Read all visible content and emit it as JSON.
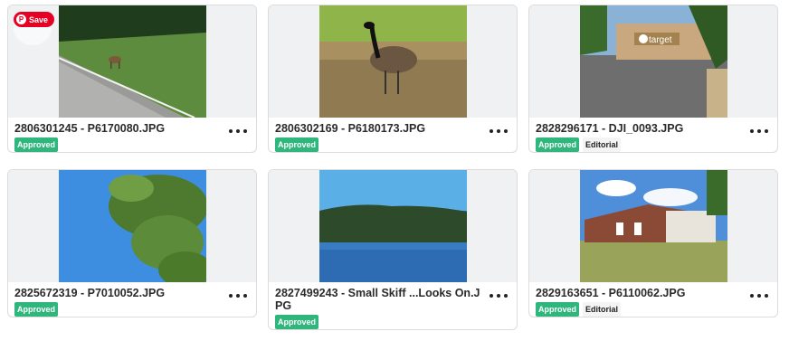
{
  "save_button": {
    "label": "Save"
  },
  "cards": [
    {
      "filename": "2806301245 - P6170080.JPG",
      "badges": [
        "Approved"
      ]
    },
    {
      "filename": "2806302169 - P6180173.JPG",
      "badges": [
        "Approved"
      ]
    },
    {
      "filename": "2828296171 - DJI_0093.JPG",
      "badges": [
        "Approved",
        "Editorial"
      ]
    },
    {
      "filename": "2825672319 - P7010052.JPG",
      "badges": [
        "Approved"
      ]
    },
    {
      "filename": "2827499243 - Small Skiff ...Looks On.JPG",
      "badges": [
        "Approved"
      ]
    },
    {
      "filename": "2829163651 - P6110062.JPG",
      "badges": [
        "Approved",
        "Editorial"
      ]
    }
  ],
  "images": [
    {
      "icon": "deer-roadside-photo"
    },
    {
      "icon": "goose-photo"
    },
    {
      "icon": "target-store-photo",
      "sign_text": "target"
    },
    {
      "icon": "tree-leaves-photo"
    },
    {
      "icon": "lake-photo"
    },
    {
      "icon": "brick-building-photo"
    }
  ],
  "colors": {
    "approved": "#2fb67c",
    "save_red": "#e60023"
  }
}
